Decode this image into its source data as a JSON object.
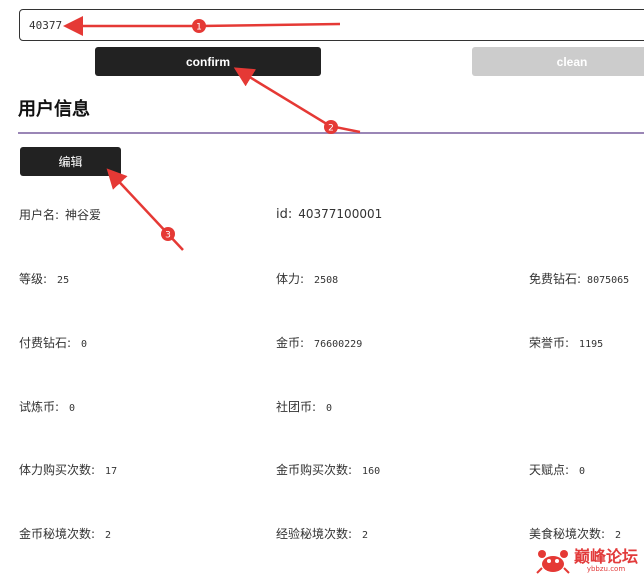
{
  "search": {
    "value": "40377"
  },
  "buttons": {
    "confirm": "confirm",
    "clean": "clean",
    "edit": "编辑"
  },
  "section_title": "用户信息",
  "profile": {
    "username_label": "用户名:",
    "username_value": "神谷爱",
    "id_label": "id:",
    "id_value": "40377100001"
  },
  "stats": [
    {
      "label": "等级:",
      "value": "25"
    },
    {
      "label": "体力:",
      "value": "2508"
    },
    {
      "label": "免费钻石:",
      "value": "8075065"
    },
    {
      "label": "付费钻石:",
      "value": "0"
    },
    {
      "label": "金币:",
      "value": "76600229"
    },
    {
      "label": "荣誉币:",
      "value": "1195"
    },
    {
      "label": "试炼币:",
      "value": "0"
    },
    {
      "label": "社团币:",
      "value": "0"
    },
    {
      "label": "体力购买次数:",
      "value": "17"
    },
    {
      "label": "金币购买次数:",
      "value": "160"
    },
    {
      "label": "天赋点:",
      "value": "0"
    },
    {
      "label": "金币秘境次数:",
      "value": "2"
    },
    {
      "label": "经验秘境次数:",
      "value": "2"
    },
    {
      "label": "美食秘境次数:",
      "value": "2"
    }
  ],
  "annotations": {
    "marker1": "1",
    "marker2": "2",
    "marker3": "3"
  },
  "watermark": {
    "name": "巅峰论坛",
    "domain": "ybbzu.com"
  },
  "colors": {
    "accent_divider": "#9a86b6",
    "annotation_red": "#e53935",
    "button_dark": "#222222",
    "button_disabled": "#cccccc"
  }
}
